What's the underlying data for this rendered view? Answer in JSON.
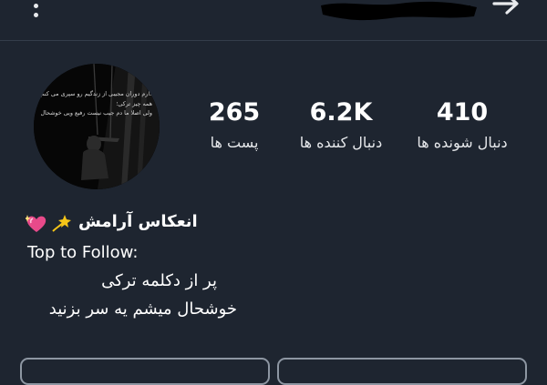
{
  "header": {
    "menu_icon": "more-vertical-icon",
    "back_icon": "arrow-right-icon"
  },
  "profile": {
    "avatar_caption_lines": [
      "دارم دوران مجیبی از زندگیم رو سپری می کنم",
      "همه چیز ترکی؛",
      "ولی اصلا ما دم جیب نیست رفیع ویی خوشحال نمیبه"
    ],
    "stats": [
      {
        "value": "265",
        "label": "پست ها"
      },
      {
        "value": "6.2K",
        "label": "دنبال کننده ها"
      },
      {
        "value": "410",
        "label": "دنبال شونده ها"
      }
    ],
    "display_name": "انعکاس آرامش",
    "name_emojis": [
      "sparkling-heart",
      "dizzy-star"
    ],
    "bio_lines": [
      "Top to Follow:",
      "پر از دکلمه ترکی",
      "خوشحال میشم یه سر بزنید"
    ]
  },
  "colors": {
    "background": "#1e2530",
    "text": "#ffffff",
    "button_border": "#8d96a2",
    "heart_pink": "#e84a8a",
    "star_yellow": "#f5c518"
  }
}
